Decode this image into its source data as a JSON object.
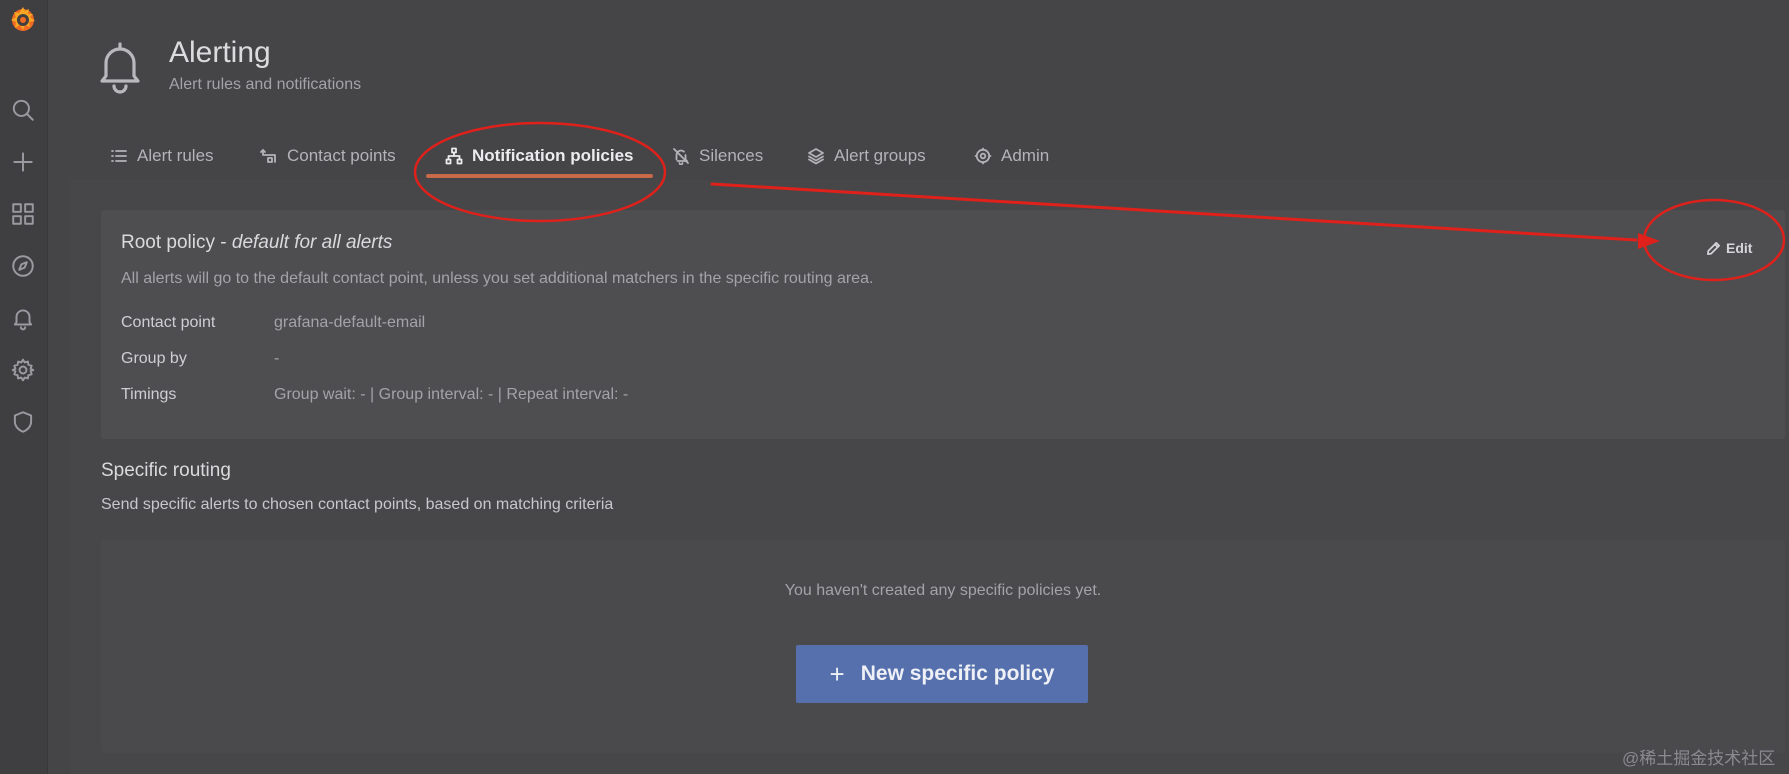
{
  "header": {
    "title": "Alerting",
    "subtitle": "Alert rules and notifications"
  },
  "tabs": [
    {
      "label": "Alert rules",
      "icon": "list-icon"
    },
    {
      "label": "Contact points",
      "icon": "contact-points-icon"
    },
    {
      "label": "Notification policies",
      "icon": "sitemap-icon",
      "active": true
    },
    {
      "label": "Silences",
      "icon": "bell-slash-icon"
    },
    {
      "label": "Alert groups",
      "icon": "layers-icon"
    },
    {
      "label": "Admin",
      "icon": "gear-icon"
    }
  ],
  "root_policy": {
    "title": "Root policy - ",
    "title_emphasis": "default for all alerts",
    "description": "All alerts will go to the default contact point, unless you set additional matchers in the specific routing area.",
    "edit_label": "Edit",
    "details": [
      {
        "label": "Contact point",
        "value": "grafana-default-email"
      },
      {
        "label": "Group by",
        "value": "-"
      },
      {
        "label": "Timings",
        "value": "Group wait: - | Group interval: - | Repeat interval: -"
      }
    ]
  },
  "specific_routing": {
    "title": "Specific routing",
    "description": "Send specific alerts to chosen contact points, based on matching criteria",
    "empty_text": "You haven't created any specific policies yet.",
    "button_label": "New specific policy"
  },
  "sidebar": {
    "items": [
      "grafana-logo",
      "search-icon",
      "plus-icon",
      "dashboards-icon",
      "explore-icon",
      "bell-icon",
      "gear-icon",
      "shield-icon"
    ]
  },
  "colors": {
    "accent": "#c8694a",
    "primary_button": "#5570ad",
    "annotation": "#e0201a"
  },
  "watermark": "@稀土掘金技术社区"
}
